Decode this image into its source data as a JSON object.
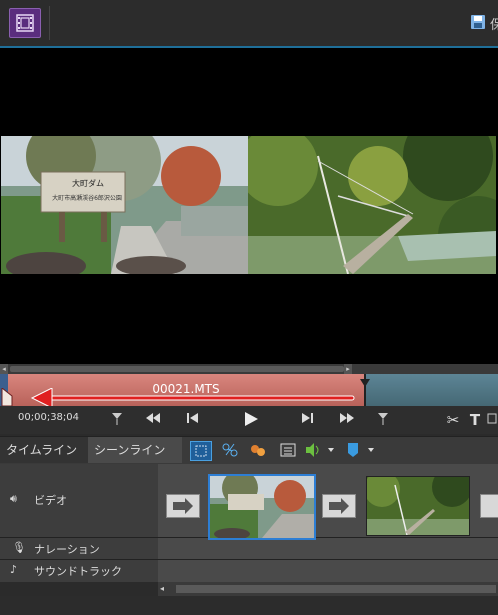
{
  "header": {
    "save_label": "保"
  },
  "clip": {
    "name": "00021.MTS"
  },
  "transport": {
    "timecode": "00;00;38;04"
  },
  "tabs": [
    {
      "label": "タイムライン"
    },
    {
      "label": "シーンライン"
    }
  ],
  "tracks": {
    "video": "ビデオ",
    "narration": "ナレーション",
    "soundtrack": "サウンドトラック"
  },
  "preview": {
    "sign_line1": "大町ダム",
    "sign_line2": "大町市高瀬渓谷6郎沢公園"
  },
  "colors": {
    "accent": "#2d7ed4",
    "clip": "#c8706a",
    "app_icon": "#5a2d7e"
  },
  "icons": [
    "film-icon",
    "save-icon",
    "marker-icon",
    "rewind-icon",
    "step-back-icon",
    "play-icon",
    "step-forward-icon",
    "fast-forward-icon",
    "split-marker-icon",
    "scissors-icon",
    "text-icon",
    "speaker-icon",
    "microphone-icon",
    "music-icon",
    "arrow-icon"
  ]
}
